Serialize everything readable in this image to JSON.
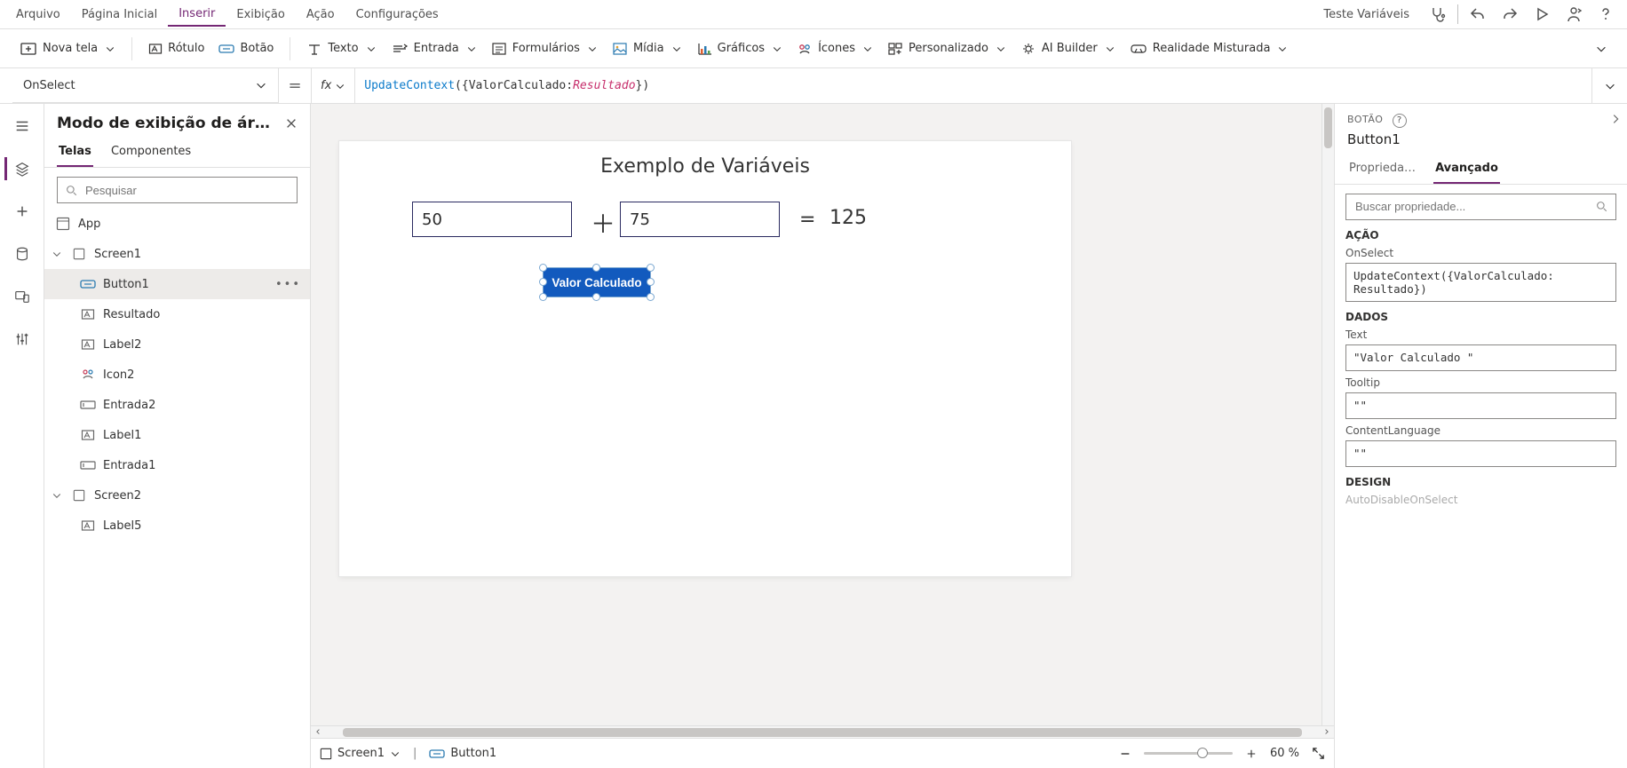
{
  "menu": {
    "tabs": [
      "Arquivo",
      "Página Inicial",
      "Inserir",
      "Exibição",
      "Ação",
      "Configurações"
    ],
    "active": 2,
    "filename": "Teste Variáveis"
  },
  "ribbon": {
    "items": [
      "Nova tela",
      "Rótulo",
      "Botão",
      "Texto",
      "Entrada",
      "Formulários",
      "Mídia",
      "Gráficos",
      "Ícones",
      "Personalizado",
      "AI Builder",
      "Realidade Misturada"
    ]
  },
  "formula": {
    "property": "OnSelect",
    "fx": "fx",
    "expr_fn": "UpdateContext",
    "expr_open": "({",
    "expr_key": "ValorCalculado",
    "expr_colon": ": ",
    "expr_id": "Resultado",
    "expr_close": "})"
  },
  "tree": {
    "title": "Modo de exibição de ár…",
    "tabs": [
      "Telas",
      "Componentes"
    ],
    "active": 0,
    "search_placeholder": "Pesquisar",
    "app": "App",
    "nodes": [
      {
        "name": "Screen1",
        "depth": 1,
        "expand": true,
        "icon": "screen"
      },
      {
        "name": "Button1",
        "depth": 2,
        "sel": true,
        "icon": "button",
        "dots": true
      },
      {
        "name": "Resultado",
        "depth": 2,
        "icon": "label"
      },
      {
        "name": "Label2",
        "depth": 2,
        "icon": "label"
      },
      {
        "name": "Icon2",
        "depth": 2,
        "icon": "iconitem"
      },
      {
        "name": "Entrada2",
        "depth": 2,
        "icon": "input"
      },
      {
        "name": "Label1",
        "depth": 2,
        "icon": "label"
      },
      {
        "name": "Entrada1",
        "depth": 2,
        "icon": "input"
      },
      {
        "name": "Screen2",
        "depth": 1,
        "expand": true,
        "icon": "screen"
      },
      {
        "name": "Label5",
        "depth": 2,
        "icon": "label"
      }
    ]
  },
  "canvas": {
    "title": "Exemplo de Variáveis",
    "input1": "50",
    "input2": "75",
    "result": "125",
    "button": "Valor Calculado",
    "crumb_screen": "Screen1",
    "crumb_sel": "Button1",
    "zoom": "60",
    "zoom_unit": "%"
  },
  "props": {
    "category": "BOTÃO",
    "element": "Button1",
    "tabs": [
      "Proprieda…",
      "Avançado"
    ],
    "active": 1,
    "search_placeholder": "Buscar propriedade...",
    "sections": {
      "acao": "AÇÃO",
      "dados": "DADOS",
      "design": "DESIGN"
    },
    "fields": {
      "onselect_label": "OnSelect",
      "onselect_value": "UpdateContext({ValorCalculado: Resultado})",
      "text_label": "Text",
      "text_value": "\"Valor Calculado \"",
      "tooltip_label": "Tooltip",
      "tooltip_value": "\"\"",
      "contentlang_label": "ContentLanguage",
      "contentlang_value": "\"\"",
      "autodisable_label": "AutoDisableOnSelect"
    }
  }
}
